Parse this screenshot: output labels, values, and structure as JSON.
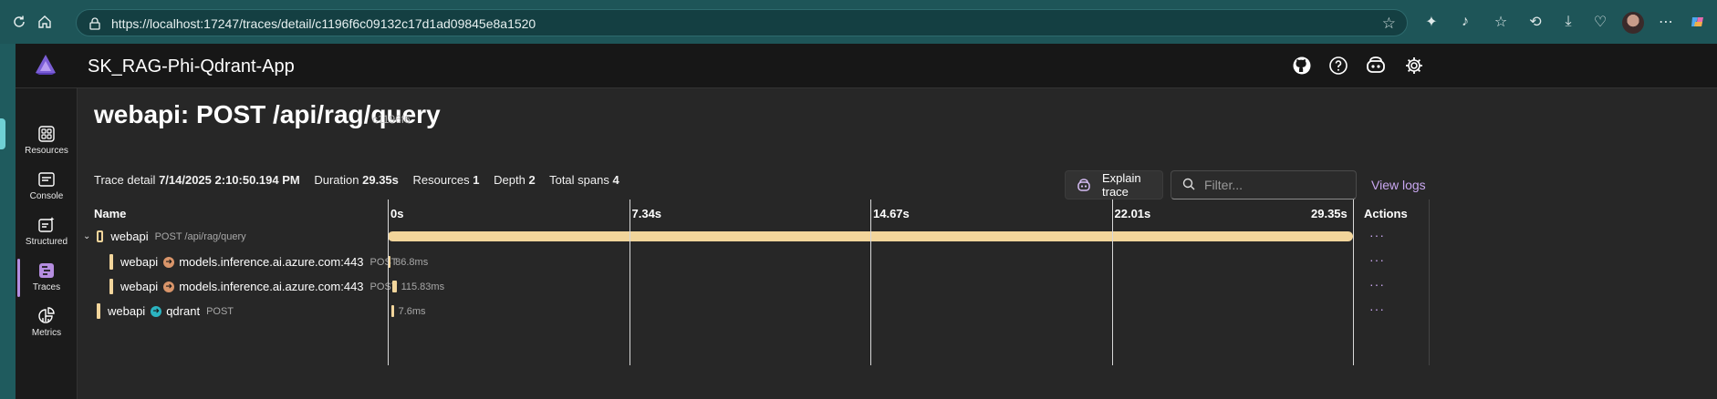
{
  "browser": {
    "url": "https://localhost:17247/traces/detail/c1196f6c09132c17d1ad09845e8a1520"
  },
  "app": {
    "title": "SK_RAG-Phi-Qdrant-App"
  },
  "nav": {
    "items": [
      {
        "label": "Resources",
        "icon": "resources-icon"
      },
      {
        "label": "Console",
        "icon": "console-icon"
      },
      {
        "label": "Structured",
        "icon": "structured-icon"
      },
      {
        "label": "Traces",
        "icon": "traces-icon"
      },
      {
        "label": "Metrics",
        "icon": "metrics-icon"
      }
    ],
    "active": "Traces"
  },
  "page": {
    "title": "webapi: POST /api/rag/query",
    "trace_id": "c1196f6"
  },
  "meta": {
    "trace_detail_label": "Trace detail",
    "trace_detail_value": "7/14/2025 2:10:50.194 PM",
    "duration_label": "Duration",
    "duration_value": "29.35s",
    "resources_label": "Resources",
    "resources_value": "1",
    "depth_label": "Depth",
    "depth_value": "2",
    "total_spans_label": "Total spans",
    "total_spans_value": "4"
  },
  "toolbar": {
    "explain_label": "Explain trace",
    "filter_placeholder": "Filter...",
    "view_logs_label": "View logs"
  },
  "grid": {
    "headers": {
      "name": "Name",
      "actions": "Actions"
    },
    "ticks": [
      "0s",
      "7.34s",
      "14.67s",
      "22.01s",
      "29.35s"
    ],
    "total_seconds": 29.35,
    "spans": [
      {
        "service": "webapi",
        "detail": "POST /api/rag/query",
        "target": "",
        "method": "",
        "start": 0,
        "duration": 29.35,
        "duration_label": "",
        "depth": 0,
        "kind": "server",
        "icon_color": "#f2d59b"
      },
      {
        "service": "webapi",
        "detail": "",
        "target": "models.inference.ai.azure.com:443",
        "method": "POST",
        "start": 0,
        "duration": 0.0868,
        "duration_label": "86.8ms",
        "depth": 1,
        "kind": "client",
        "icon_color": "#d9956a"
      },
      {
        "service": "webapi",
        "detail": "",
        "target": "models.inference.ai.azure.com:443",
        "method": "POST",
        "start": 0.15,
        "duration": 0.11583,
        "duration_label": "115.83ms",
        "depth": 1,
        "kind": "client",
        "icon_color": "#d9956a"
      },
      {
        "service": "webapi",
        "detail": "",
        "target": "qdrant",
        "method": "POST",
        "start": 0.1,
        "duration": 0.0076,
        "duration_label": "7.6ms",
        "depth": 0,
        "kind": "client",
        "icon_color": "#2bb3c0"
      }
    ]
  },
  "colors": {
    "span_bar": "#f2d59b",
    "accent": "#c9a7f0"
  }
}
